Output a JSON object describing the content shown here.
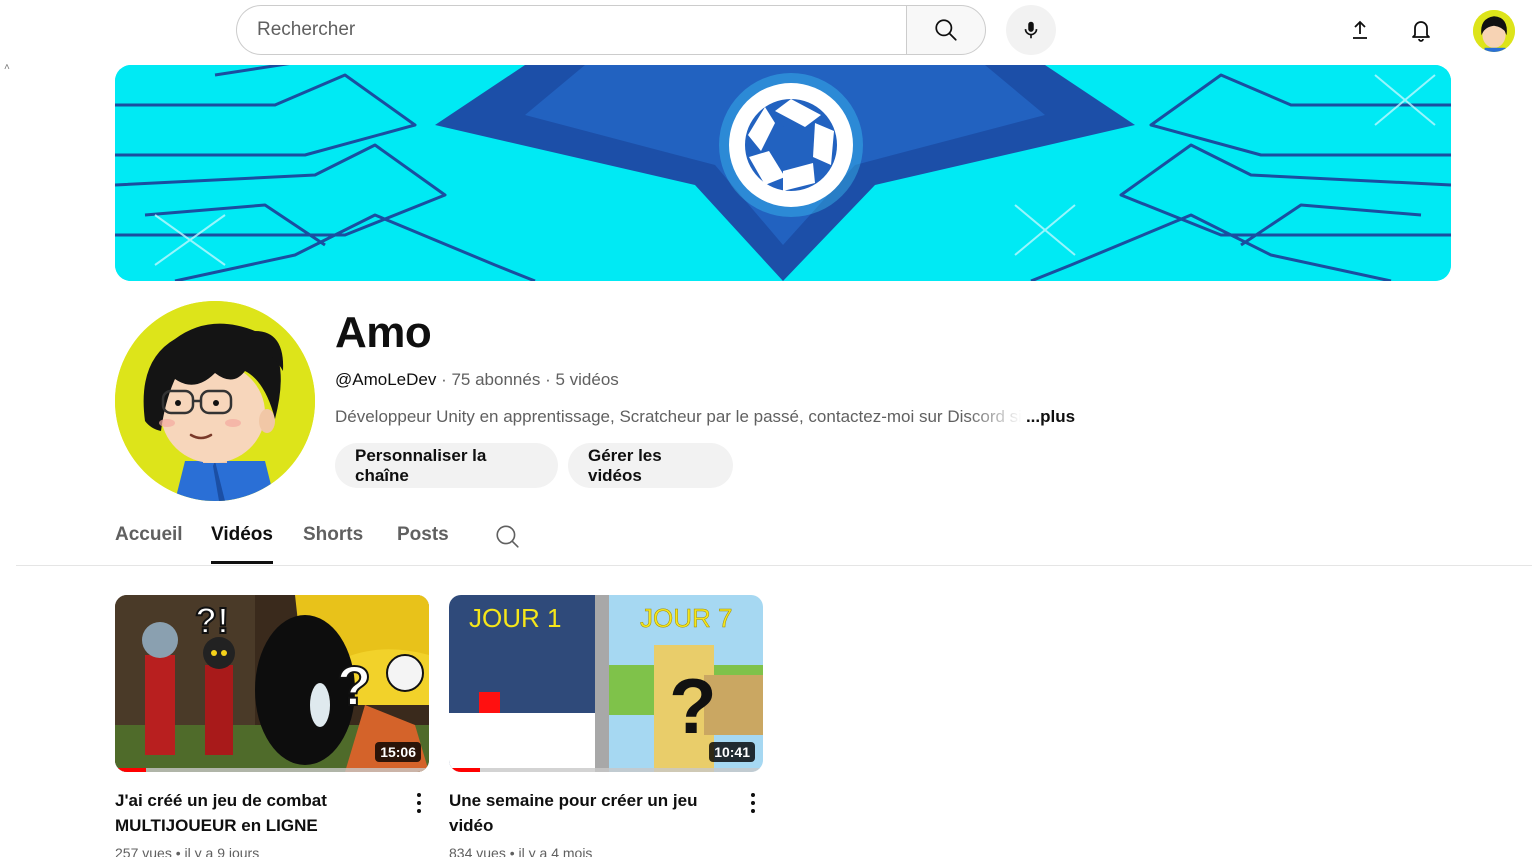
{
  "search": {
    "placeholder": "Rechercher"
  },
  "channel": {
    "name": "Amo",
    "handle": "@AmoLeDev",
    "subscribers": "75 abonnés",
    "video_count": "5 vidéos",
    "separator": " · ",
    "description": "Développeur Unity en apprentissage, Scratcheur par le passé, contactez-moi sur Discord si",
    "more_label": "...plus",
    "avatar_color": "#dde41a"
  },
  "actions": {
    "customize_label": "Personnaliser la chaîne",
    "manage_label": "Gérer les vidéos"
  },
  "tabs": [
    {
      "label": "Accueil",
      "active": false
    },
    {
      "label": "Vidéos",
      "active": true
    },
    {
      "label": "Shorts",
      "active": false
    },
    {
      "label": "Posts",
      "active": false
    }
  ],
  "icons": {
    "search": "search-icon",
    "mic": "mic-icon",
    "upload": "upload-icon",
    "bell": "bell-icon",
    "tab_search": "search-icon",
    "menu": "more-vertical-icon"
  },
  "videos": [
    {
      "title": "J'ai créé un jeu de combat MULTIJOUEUR en LIGNE",
      "duration": "15:06",
      "views": "257 vues",
      "age": "il y a 9 jours",
      "watched_fraction": 0.1
    },
    {
      "title": "Une semaine pour créer un jeu vidéo",
      "duration": "10:41",
      "views": "834 vues",
      "age": "il y a 4 mois",
      "watched_fraction": 0.1,
      "thumb_left_text": "JOUR 1",
      "thumb_right_text": "JOUR 7",
      "thumb_mark": "?"
    }
  ],
  "colors": {
    "banner": "#00e9f2",
    "accent_red": "#ff0000",
    "text_secondary": "#606060"
  }
}
